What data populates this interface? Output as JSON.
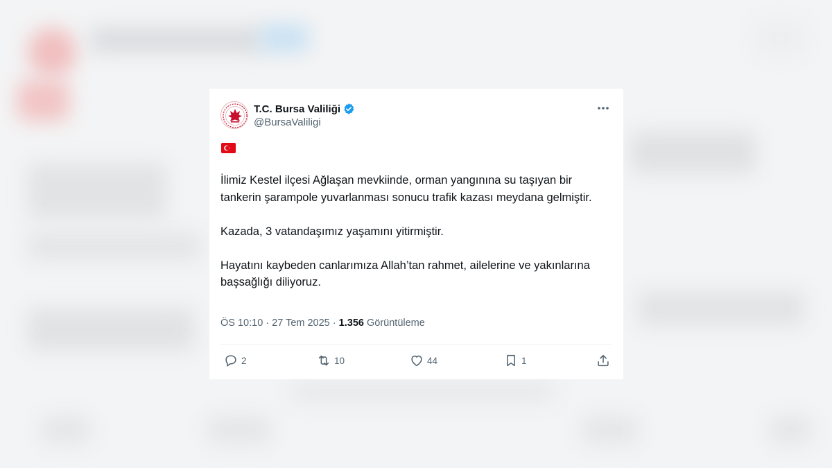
{
  "tweet": {
    "display_name": "T.C. Bursa Valiliği",
    "handle": "@BursaValiligi",
    "paragraphs": [
      "İlimiz Kestel ilçesi Ağlaşan mevkiinde, orman yangınına su taşıyan bir tankerin şarampole yuvarlanması sonucu trafik kazası meydana gelmiştir.",
      "Kazada, 3 vatandaşımız yaşamını yitirmiştir.",
      "Hayatını kaybeden canlarımıza Allah’tan rahmet, ailelerine ve yakınlarına başsağlığı diliyoruz."
    ],
    "time": "ÖS 10:10",
    "separator": "·",
    "date": "27 Tem 2025",
    "views_count": "1.356",
    "views_label": "Görüntüleme"
  },
  "actions": {
    "replies": "2",
    "retweets": "10",
    "likes": "44",
    "bookmarks": "1"
  },
  "icons": {
    "flag": "turkey-flag-icon",
    "verified": "verified-badge-icon",
    "more": "more-options-icon",
    "reply": "reply-icon",
    "retweet": "retweet-icon",
    "like": "heart-icon",
    "bookmark": "bookmark-icon",
    "share": "share-icon"
  },
  "colors": {
    "accent": "#1d9bf0",
    "text": "#0f1419",
    "secondary_text": "#536471",
    "flag_red": "#e30a17",
    "logo_red": "#c8102e"
  }
}
